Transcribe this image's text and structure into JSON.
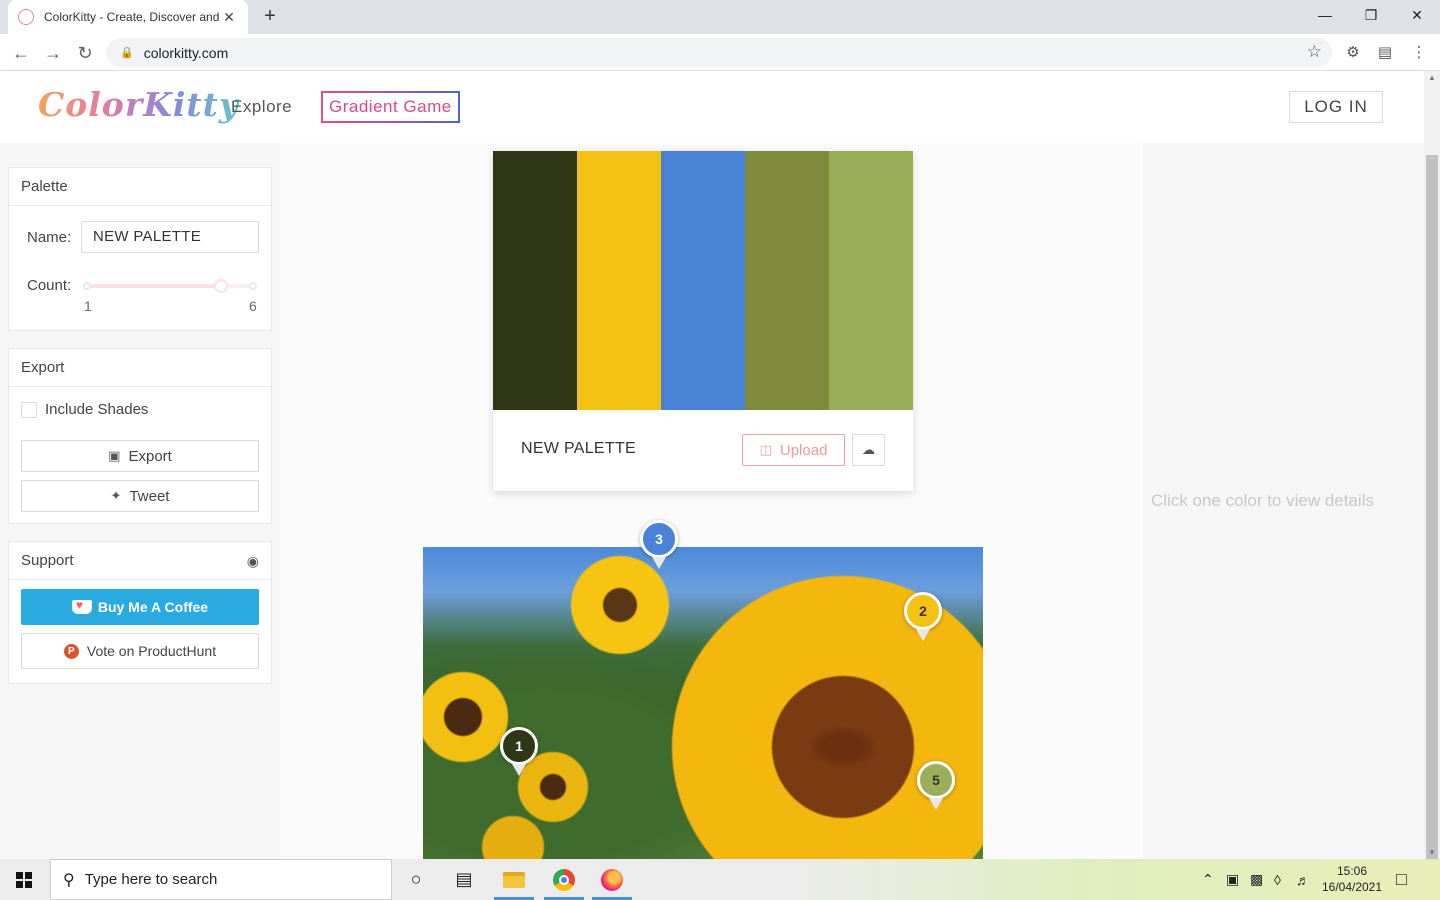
{
  "browser": {
    "tab_title": "ColorKitty - Create, Discover and",
    "tab_close": "✕",
    "new_tab": "+",
    "url": "colorkitty.com",
    "window_controls": {
      "minimize": "—",
      "restore": "❐",
      "close": "✕"
    }
  },
  "header": {
    "logo": "ColorKitty",
    "nav": {
      "explore": "Explore",
      "gradient_game": "Gradient Game"
    },
    "login": "LOG IN"
  },
  "sidebar": {
    "palette": {
      "title": "Palette",
      "name_label": "Name:",
      "name_value": "NEW PALETTE",
      "count_label": "Count:",
      "count_min": "1",
      "count_max": "6",
      "count_value": 5
    },
    "export": {
      "title": "Export",
      "include_shades": "Include Shades",
      "export_button": "Export",
      "tweet_button": "Tweet"
    },
    "support": {
      "title": "Support",
      "buy_coffee": "Buy Me A Coffee",
      "vote_producthunt": "Vote on ProductHunt",
      "producthunt_letter": "P"
    }
  },
  "palette_card": {
    "colors": [
      "#2e3616",
      "#f3c214",
      "#4a83d6",
      "#7f8a3d",
      "#9aae5a"
    ],
    "name": "NEW PALETTE",
    "upload_button": "Upload"
  },
  "markers": [
    {
      "label": "1",
      "color": "#2e3616"
    },
    {
      "label": "2",
      "color": "#f3c214"
    },
    {
      "label": "3",
      "color": "#4a83d6"
    },
    {
      "label": "5",
      "color": "#9aae5a"
    }
  ],
  "right_panel": {
    "hint": "Click one color to view details"
  },
  "taskbar": {
    "search_placeholder": "Type here to search",
    "time": "15:06",
    "date": "16/04/2021"
  }
}
